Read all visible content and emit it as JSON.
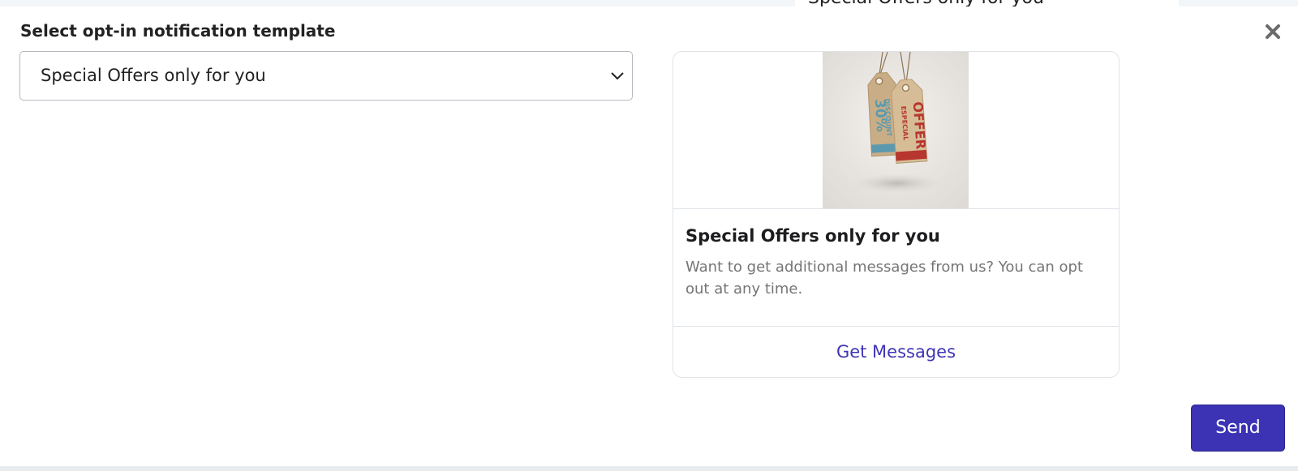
{
  "background": {
    "panel_text": "Special Offers only for you"
  },
  "modal": {
    "title": "Select opt-in notification template",
    "close_icon": "close-icon"
  },
  "template_select": {
    "selected": "Special Offers only for you",
    "chevron_icon": "chevron-down-icon"
  },
  "preview": {
    "image_tags": {
      "tag1": "DISCOUNT",
      "tag1_value": "30%",
      "tag2_small": "ESPECIAL",
      "tag2_big": "OFFER"
    },
    "title": "Special Offers only for you",
    "description": "Want to get additional messages from us? You can opt out at any time.",
    "button_label": "Get Messages"
  },
  "actions": {
    "send_label": "Send"
  },
  "colors": {
    "accent": "#3b33b3",
    "link": "#3f35b5",
    "muted_text": "#757575"
  }
}
